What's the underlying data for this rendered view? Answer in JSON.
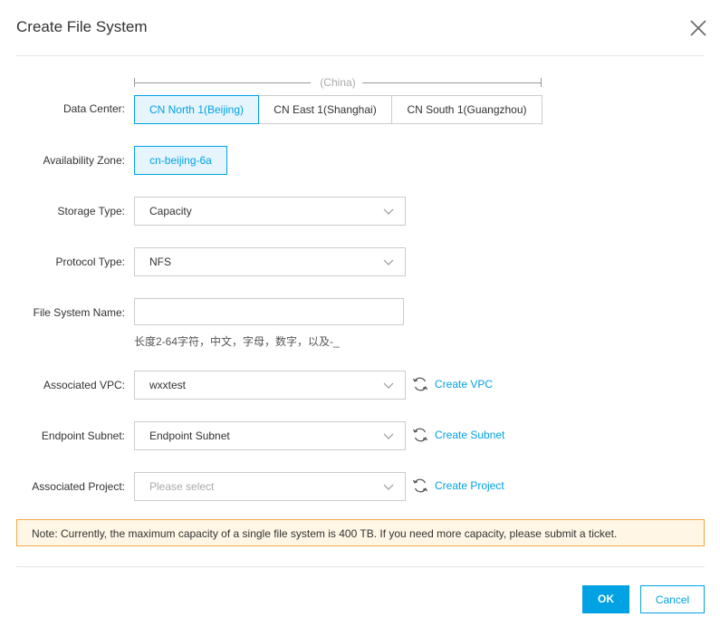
{
  "dialog": {
    "title": "Create File System"
  },
  "form": {
    "data_center": {
      "label": "Data Center:",
      "region_group": "(China)",
      "options": [
        "CN North 1(Beijing)",
        "CN East 1(Shanghai)",
        "CN South 1(Guangzhou)"
      ],
      "selected": "CN North 1(Beijing)"
    },
    "availability_zone": {
      "label": "Availability Zone:",
      "value": "cn-beijing-6a"
    },
    "storage_type": {
      "label": "Storage Type:",
      "value": "Capacity"
    },
    "protocol_type": {
      "label": "Protocol Type:",
      "value": "NFS"
    },
    "file_system_name": {
      "label": "File System Name:",
      "value": "",
      "hint": "长度2-64字符，中文，字母，数字，以及-_"
    },
    "associated_vpc": {
      "label": "Associated VPC:",
      "value": "wxxtest",
      "action": "Create VPC"
    },
    "endpoint_subnet": {
      "label": "Endpoint Subnet:",
      "value": "Endpoint Subnet",
      "action": "Create Subnet"
    },
    "associated_project": {
      "label": "Associated Project:",
      "placeholder": "Please select",
      "action": "Create Project"
    }
  },
  "note": "Note: Currently, the maximum capacity of a single file system is 400 TB. If you need more capacity, please submit a ticket.",
  "footer": {
    "ok_label": "OK",
    "cancel_label": "Cancel"
  },
  "colors": {
    "accent": "#00a2e3",
    "note_bg": "#fff6e5",
    "note_border": "#f0a94a"
  },
  "icons": {
    "close": "close-icon",
    "dropdown": "chevron-down-icon",
    "refresh": "refresh-icon"
  }
}
